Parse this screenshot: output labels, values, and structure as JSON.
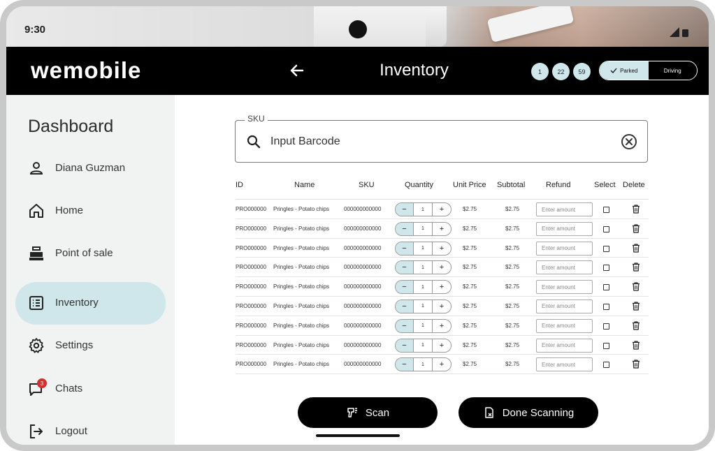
{
  "status_bar": {
    "time": "9:30"
  },
  "header": {
    "brand": "wemobile",
    "title": "Inventory",
    "badges": [
      "1",
      "22",
      "59"
    ],
    "mode": {
      "parked": "Parked",
      "driving": "Driving",
      "active": "Parked"
    }
  },
  "sidebar": {
    "title": "Dashboard",
    "items": [
      {
        "label": "Diana Guzman",
        "icon": "person-icon"
      },
      {
        "label": "Home",
        "icon": "home-icon"
      },
      {
        "label": "Point of sale",
        "icon": "cash-register-icon"
      },
      {
        "label": "Inventory",
        "icon": "list-icon",
        "active": true
      },
      {
        "label": "Settings",
        "icon": "gear-icon"
      },
      {
        "label": "Chats",
        "icon": "chat-icon",
        "badge": "3"
      },
      {
        "label": "Logout",
        "icon": "logout-icon"
      }
    ]
  },
  "search": {
    "legend": "SKU",
    "placeholder": "Input Barcode"
  },
  "table": {
    "headers": [
      "ID",
      "Name",
      "SKU",
      "Quantity",
      "Unit Price",
      "Subtotal",
      "Refund",
      "Select",
      "Delete"
    ],
    "refund_placeholder": "Enter amount",
    "rows": [
      {
        "id": "PRO000000",
        "name": "Pringles - Potato chips",
        "sku": "000000000000",
        "qty": "1",
        "unit_price": "$2.75",
        "subtotal": "$2.75"
      },
      {
        "id": "PRO000000",
        "name": "Pringles - Potato chips",
        "sku": "000000000000",
        "qty": "1",
        "unit_price": "$2.75",
        "subtotal": "$2.75"
      },
      {
        "id": "PRO000000",
        "name": "Pringles - Potato chips",
        "sku": "000000000000",
        "qty": "1",
        "unit_price": "$2.75",
        "subtotal": "$2.75"
      },
      {
        "id": "PRO000000",
        "name": "Pringles - Potato chips",
        "sku": "000000000000",
        "qty": "1",
        "unit_price": "$2.75",
        "subtotal": "$2.75"
      },
      {
        "id": "PRO000000",
        "name": "Pringles - Potato chips",
        "sku": "000000000000",
        "qty": "1",
        "unit_price": "$2.75",
        "subtotal": "$2.75"
      },
      {
        "id": "PRO000000",
        "name": "Pringles - Potato chips",
        "sku": "000000000000",
        "qty": "1",
        "unit_price": "$2.75",
        "subtotal": "$2.75"
      },
      {
        "id": "PRO000000",
        "name": "Pringles - Potato chips",
        "sku": "000000000000",
        "qty": "1",
        "unit_price": "$2.75",
        "subtotal": "$2.75"
      },
      {
        "id": "PRO000000",
        "name": "Pringles - Potato chips",
        "sku": "000000000000",
        "qty": "1",
        "unit_price": "$2.75",
        "subtotal": "$2.75"
      },
      {
        "id": "PRO000000",
        "name": "Pringles - Potato chips",
        "sku": "000000000000",
        "qty": "1",
        "unit_price": "$2.75",
        "subtotal": "$2.75"
      }
    ]
  },
  "actions": {
    "scan": "Scan",
    "done": "Done Scanning"
  },
  "colors": {
    "accent": "#cfe6ea",
    "header_bg": "#000000",
    "sidebar_bg": "#f1f3f3",
    "badge_red": "#d32f2f"
  }
}
